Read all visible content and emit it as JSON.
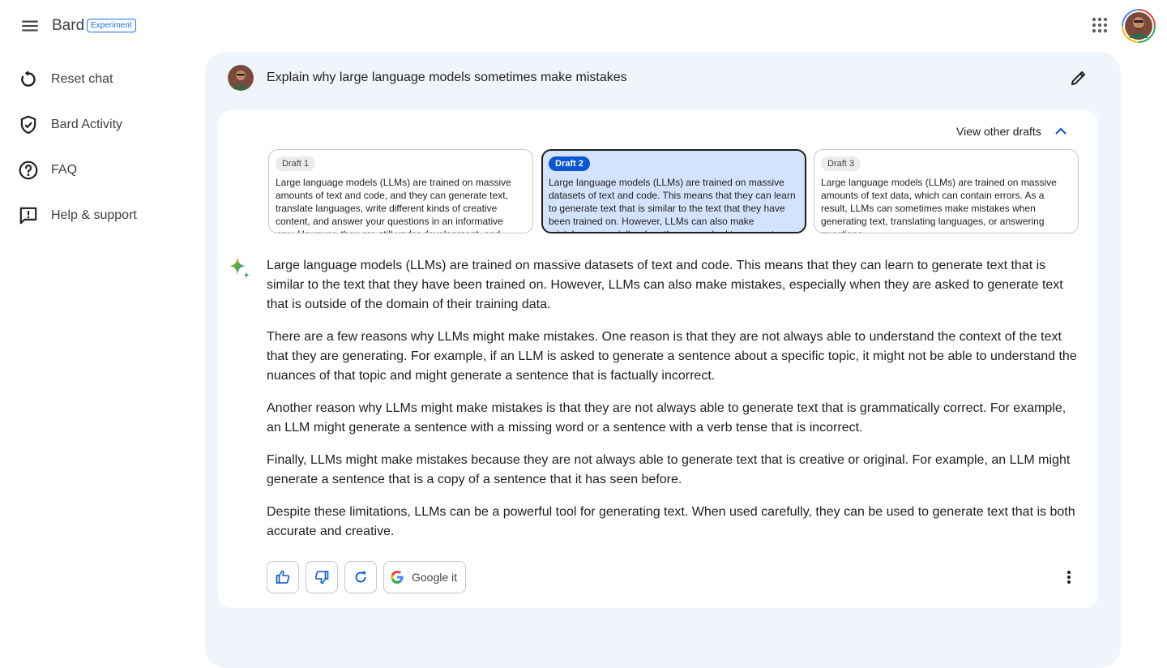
{
  "header": {
    "brand": "Bard",
    "badge": "Experiment"
  },
  "sidebar": {
    "items": [
      {
        "label": "Reset chat",
        "icon": "reset-icon"
      },
      {
        "label": "Bard Activity",
        "icon": "shield-check-icon"
      },
      {
        "label": "FAQ",
        "icon": "help-circle-icon"
      },
      {
        "label": "Help & support",
        "icon": "feedback-icon"
      }
    ]
  },
  "prompt": {
    "text": "Explain why large language models sometimes make mistakes"
  },
  "drafts": {
    "toggle_label": "View other drafts",
    "items": [
      {
        "label": "Draft 1",
        "text": "Large language models (LLMs) are trained on massive amounts of text and code, and they can generate text, translate languages, write different kinds of creative content, and answer your questions in an informative way. However, they are still under development, and",
        "selected": false
      },
      {
        "label": "Draft 2",
        "text": "Large language models (LLMs) are trained on massive datasets of text and code. This means that they can learn to generate text that is similar to the text that they have been trained on. However, LLMs can also make mistakes, especially when they are asked to generate",
        "selected": true
      },
      {
        "label": "Draft 3",
        "text": "Large language models (LLMs) are trained on massive amounts of text data, which can contain errors. As a result, LLMs can sometimes make mistakes when generating text, translating languages, or answering questions",
        "selected": false
      }
    ]
  },
  "response": {
    "paragraphs": [
      "Large language models (LLMs) are trained on massive datasets of text and code. This means that they can learn to generate text that is similar to the text that they have been trained on. However, LLMs can also make mistakes, especially when they are asked to generate text that is outside of the domain of their training data.",
      "There are a few reasons why LLMs might make mistakes. One reason is that they are not always able to understand the context of the text that they are generating. For example, if an LLM is asked to generate a sentence about a specific topic, it might not be able to understand the nuances of that topic and might generate a sentence that is factually incorrect.",
      "Another reason why LLMs might make mistakes is that they are not always able to generate text that is grammatically correct. For example, an LLM might generate a sentence with a missing word or a sentence with a verb tense that is incorrect.",
      "Finally, LLMs might make mistakes because they are not always able to generate text that is creative or original. For example, an LLM might generate a sentence that is a copy of a sentence that it has seen before.",
      "Despite these limitations, LLMs can be a powerful tool for generating text. When used carefully, they can be used to generate text that is both accurate and creative."
    ]
  },
  "actions": {
    "google_it_label": "Google it"
  },
  "colors": {
    "accent": "#0b57d0",
    "panel_bg": "#f0f4fb",
    "selected_draft_bg": "#d3e3fd"
  }
}
